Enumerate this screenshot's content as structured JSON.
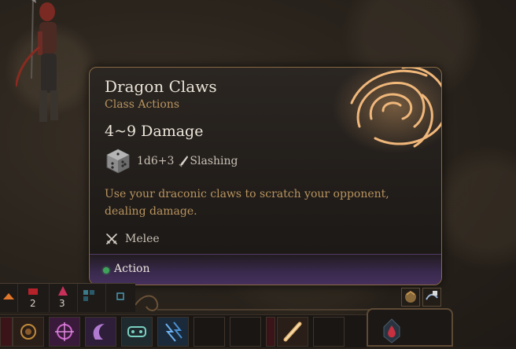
{
  "tooltip": {
    "title": "Dragon Claws",
    "subtitle": "Class Actions",
    "damage_total": "4~9 Damage",
    "dice_roll": "1d6+3",
    "damage_type": "Slashing",
    "description": "Use your draconic claws to scratch your opponent, dealing damage.",
    "range": "Melee",
    "action_type": "Action",
    "icons": {
      "dice": "d6-dice-icon",
      "damage_type": "slashing-blade-icon",
      "range": "crossed-swords-icon",
      "spell": "claw-rune-icon"
    },
    "colors": {
      "title": "#e9e2d6",
      "subtitle": "#b9945f",
      "border": "#8a6a44",
      "action_dot": "#3fa35a",
      "footer": "#45305c"
    }
  },
  "hotbar": {
    "counters": [
      "2",
      "3"
    ],
    "slots": [
      "sun-emblem-icon",
      "compass-burst-icon",
      "crescent-claw-icon",
      "mask-icon",
      "lightning-claw-icon",
      "empty",
      "empty",
      "empty",
      "scroll-icon",
      "empty",
      "empty"
    ],
    "right_slot_icons": [
      "beast-portrait-icon",
      "action-toggle-icon"
    ],
    "panel_icon": "blood-drop-icon"
  }
}
